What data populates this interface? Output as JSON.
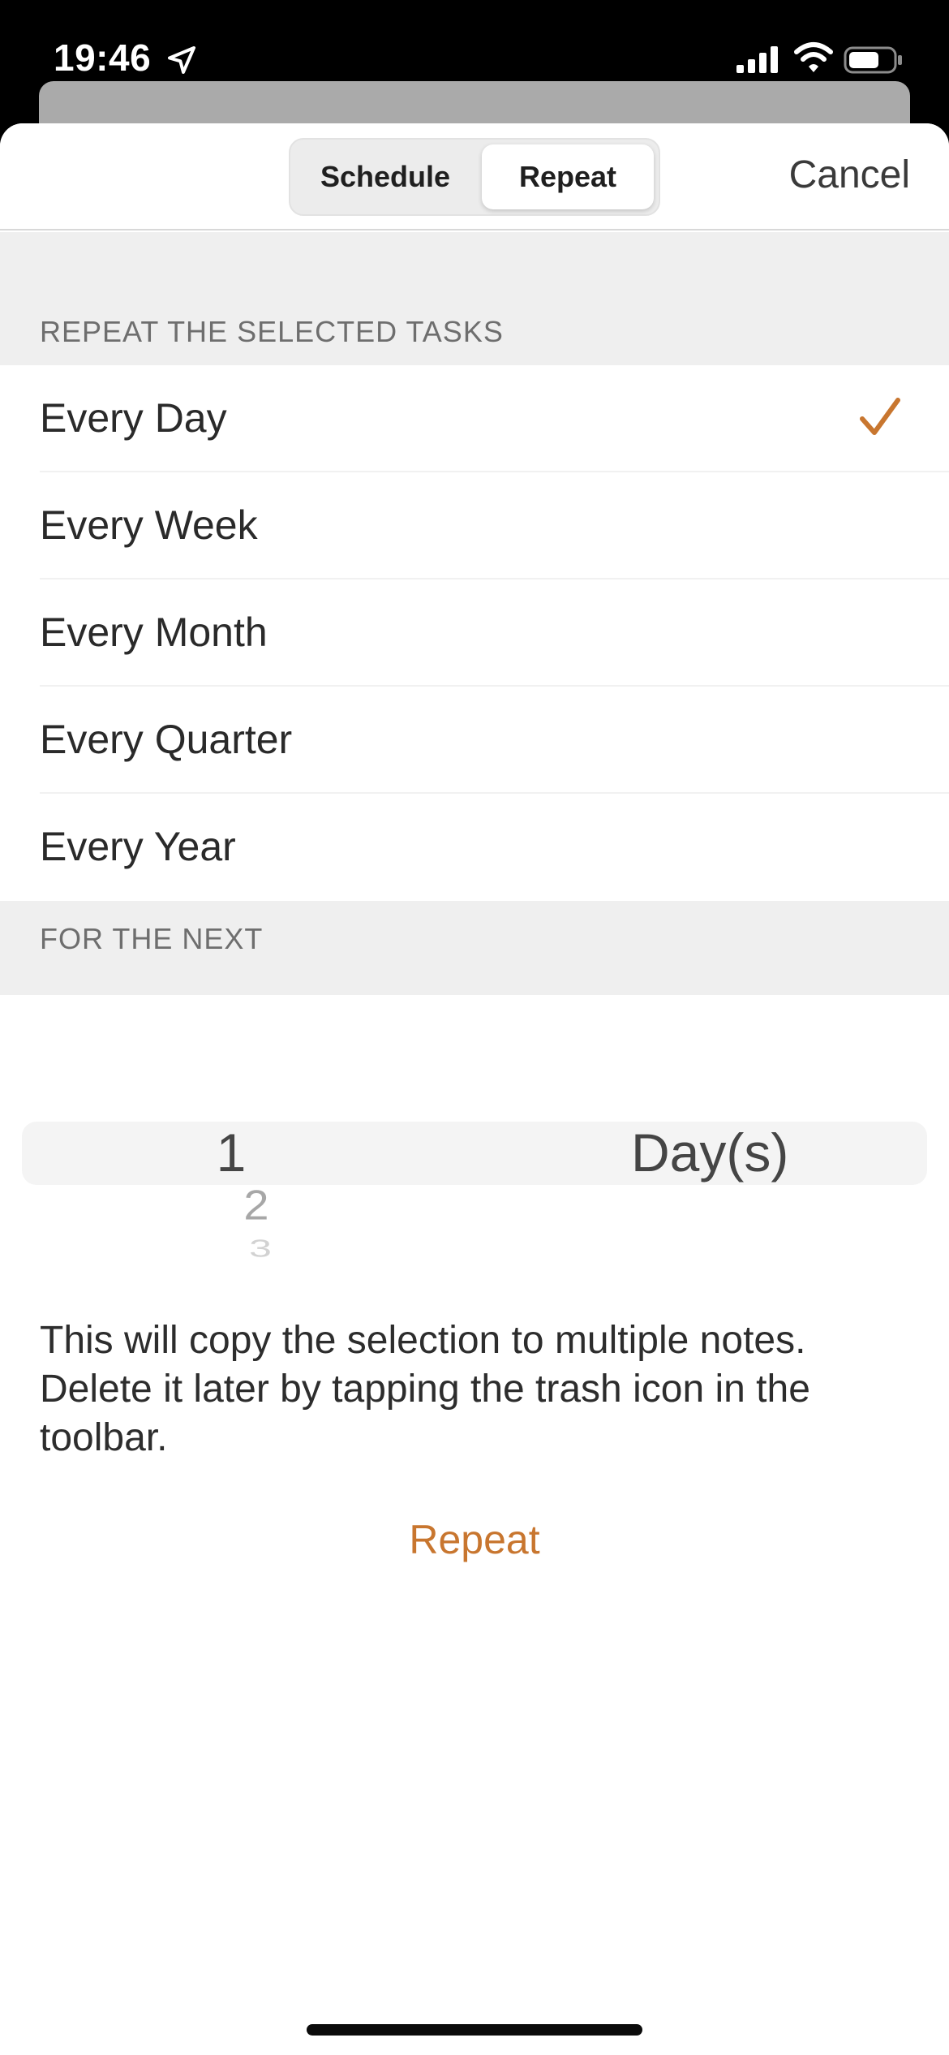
{
  "status_bar": {
    "time": "19:46",
    "icons": [
      "location-arrow-icon",
      "cellular-signal-icon",
      "wifi-icon",
      "battery-icon"
    ]
  },
  "nav": {
    "segments": [
      {
        "label": "Schedule",
        "selected": false
      },
      {
        "label": "Repeat",
        "selected": true
      }
    ],
    "cancel_label": "Cancel"
  },
  "repeat_section": {
    "header": "REPEAT THE SELECTED TASKS",
    "options": [
      {
        "label": "Every Day",
        "checked": true
      },
      {
        "label": "Every Week",
        "checked": false
      },
      {
        "label": "Every Month",
        "checked": false
      },
      {
        "label": "Every Quarter",
        "checked": false
      },
      {
        "label": "Every Year",
        "checked": false
      }
    ]
  },
  "next_section": {
    "header": "FOR THE NEXT",
    "picker": {
      "numbers": [
        "1",
        "2",
        "3"
      ],
      "selected_number": "1",
      "unit": "Day(s)"
    }
  },
  "description": "This will copy the selection to multiple notes. Delete it later by tapping the trash icon in the toolbar.",
  "repeat_button_label": "Repeat",
  "colors": {
    "accent": "#c8762f",
    "section_background": "#efefef",
    "status_bar": "#000000"
  }
}
